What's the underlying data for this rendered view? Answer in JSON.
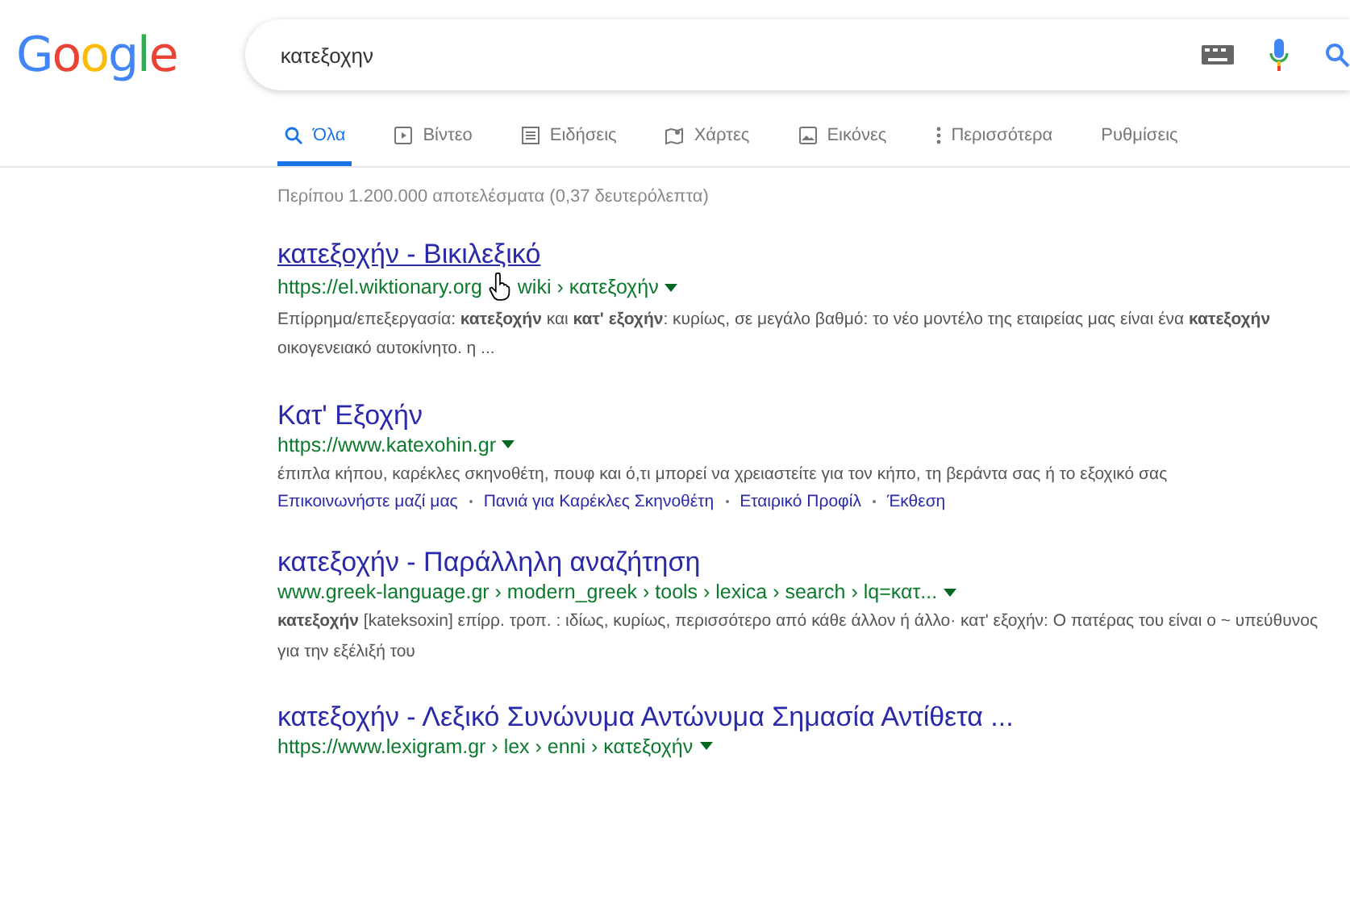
{
  "logo": "Google",
  "search": {
    "value": "κατεξοχην"
  },
  "tabs": [
    {
      "label": "Όλα",
      "selected": true
    },
    {
      "label": "Βίντεο",
      "selected": false
    },
    {
      "label": "Ειδήσεις",
      "selected": false
    },
    {
      "label": "Χάρτες",
      "selected": false
    },
    {
      "label": "Εικόνες",
      "selected": false
    },
    {
      "label": "Περισσότερα",
      "selected": false
    },
    {
      "label": "Ρυθμίσεις",
      "selected": false
    }
  ],
  "result_stats": "Περίπου 1.200.000 αποτελέσματα (0,37 δευτερόλεπτα)",
  "results": [
    {
      "title": "κατεξοχήν - Βικιλεξικό",
      "url_parts": [
        "https://el.wiktionary.org",
        "wiki › κατεξοχήν"
      ],
      "hovered": true,
      "snippet": "Επίρρημα/επεξεργασία: **κατεξοχήν** και **κατ' εξοχήν**: κυρίως, σε μεγάλο βαθμό: το νέο μοντέλο της εταιρείας μας είναι ένα **κατεξοχήν** οικογενειακό αυτοκίνητο. η ..."
    },
    {
      "title": "Κατ' Εξοχήν",
      "url": "https://www.katexohin.gr",
      "hovered": false,
      "snippet": "έπιπλα κήπου, καρέκλες σκηνοθέτη, πουφ και ό,τι μπορεί να χρειαστείτε για τον κήπο, τη βεράντα σας ή το εξοχικό σας",
      "sitelinks": [
        "Επικοινωνήστε μαζί μας",
        "Πανιά για Καρέκλες Σκηνοθέτη",
        "Εταιρικό Προφίλ",
        "Έκθεση"
      ]
    },
    {
      "title": "κατεξοχήν - Παράλληλη αναζήτηση",
      "url": "www.greek-language.gr › modern_greek › tools › lexica › search › lq=κατ...",
      "hovered": false,
      "snippet": "**κατεξοχήν** [kateksoxin] επίρρ. τροπ. : ιδίως, κυρίως, περισσότερο από κάθε άλλον ή άλλο· κατ' εξοχήν: Ο πατέρας του είναι ο ~ υπεύθυνος για την εξέλιξή του"
    },
    {
      "title": "κατεξοχήν - Λεξικό Συνώνυμα Αντώνυμα Σημασία Αντίθετα ...",
      "url": "https://www.lexigram.gr › lex › enni › κατεξοχήν",
      "hovered": false
    }
  ]
}
